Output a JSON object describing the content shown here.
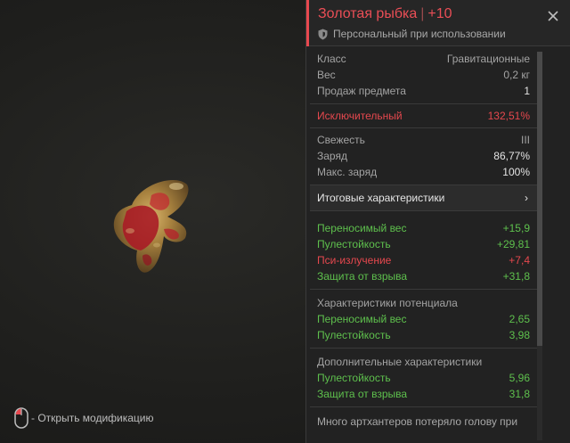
{
  "title": {
    "name": "Золотая рыбка",
    "separator": "|",
    "upgrade": "+10",
    "binding": "Персональный при использовании"
  },
  "hint": {
    "text": "- Открыть модификацию",
    "icon": "mouse-icon"
  },
  "base_stats": [
    {
      "label": "Класс",
      "value": "Гравитационные"
    },
    {
      "label": "Вес",
      "value": "0,2 кг"
    },
    {
      "label": "Продаж предмета",
      "value": "1"
    }
  ],
  "rarity": {
    "label": "Исключительный",
    "value": "132,51%"
  },
  "condition": [
    {
      "label": "Свежесть",
      "value": "III"
    },
    {
      "label": "Заряд",
      "value": "86,77%"
    },
    {
      "label": "Макс. заряд",
      "value": "100%"
    }
  ],
  "summary_button": {
    "label": "Итоговые характеристики",
    "chevron": "›"
  },
  "final_stats": [
    {
      "label": "Переносимый вес",
      "value": "+15,9"
    },
    {
      "label": "Пулестойкость",
      "value": "+29,81"
    },
    {
      "label": "Пси-излучение",
      "value": "+7,4"
    },
    {
      "label": "Защита от взрыва",
      "value": "+31,8"
    }
  ],
  "potential": {
    "title": "Характеристики потенциала",
    "items": [
      {
        "label": "Переносимый вес",
        "value": "2,65"
      },
      {
        "label": "Пулестойкость",
        "value": "3,98"
      }
    ]
  },
  "additional": {
    "title": "Дополнительные характеристики",
    "items": [
      {
        "label": "Пулестойкость",
        "value": "5,96"
      },
      {
        "label": "Защита от взрыва",
        "value": "31,8"
      }
    ]
  },
  "description": "Много артхантеров потеряло голову при",
  "colors": {
    "accent": "#e8484f",
    "positive": "#5ec04d",
    "negative": "#e6484e",
    "panel_bg": "#222222"
  },
  "scroll_position": 0
}
